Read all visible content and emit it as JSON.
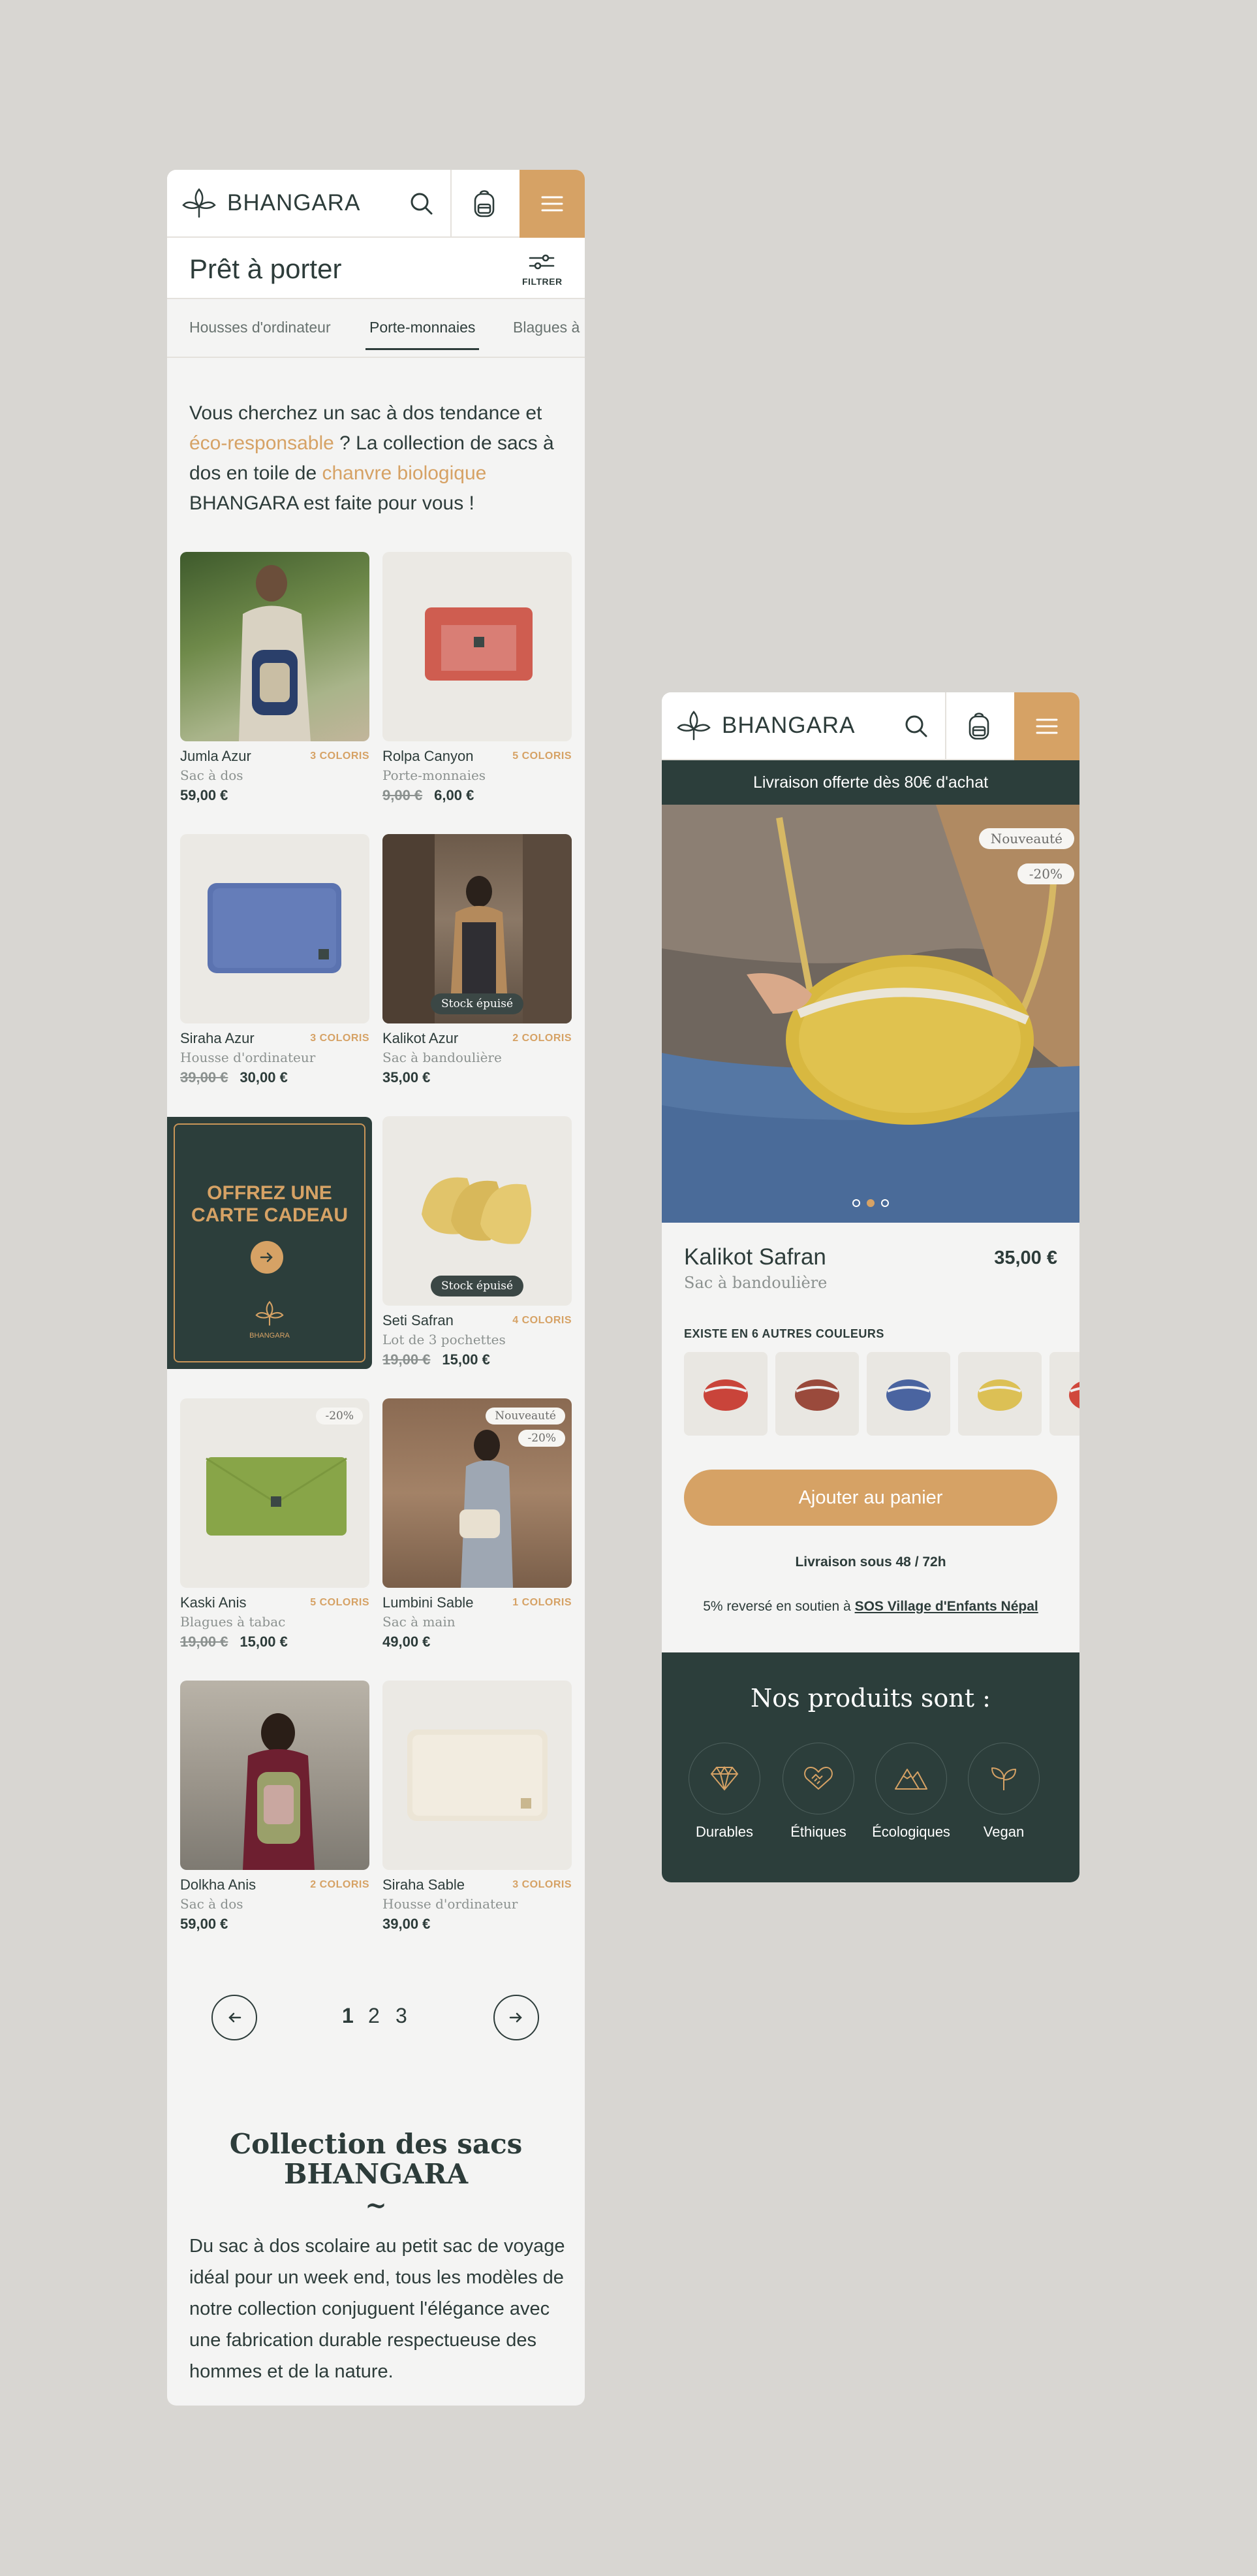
{
  "brand": "BHANGARA",
  "colors": {
    "accent": "#d6a265",
    "dark": "#2c3e3b",
    "background": "#d8d6d2"
  },
  "listing": {
    "title": "Prêt à porter",
    "filter_label": "FILTRER",
    "tabs": [
      "Housses d'ordinateur",
      "Porte-monnaies",
      "Blagues à"
    ],
    "active_tab": "Porte-monnaies",
    "intro": {
      "p1": "Vous cherchez un sac à dos tendance et ",
      "hl1": "éco-responsable",
      "p2": " ? La collection de sacs à dos en toile de ",
      "hl2": "chanvre biologique",
      "p3": " BHANGARA est faite pour vous !"
    },
    "products": [
      {
        "name": "Jumla Azur",
        "colors": "3 COLORIS",
        "category": "Sac à dos",
        "old_price": "",
        "price": "59,00 €"
      },
      {
        "name": "Rolpa Canyon",
        "colors": "5 COLORIS",
        "category": "Porte-monnaies",
        "old_price": "9,00 €",
        "price": "6,00 €"
      },
      {
        "name": "Siraha Azur",
        "colors": "3 COLORIS",
        "category": "Housse d'ordinateur",
        "old_price": "39,00 €",
        "price": "30,00 €"
      },
      {
        "name": "Kalikot Azur",
        "colors": "2 COLORIS",
        "category": "Sac à bandoulière",
        "old_price": "",
        "price": "35,00 €",
        "badge_stock": "Stock épuisé"
      },
      {
        "name": "Seti Safran",
        "colors": "4 COLORIS",
        "category": "Lot de 3 pochettes",
        "old_price": "19,00 €",
        "price": "15,00 €",
        "badge_stock": "Stock épuisé"
      },
      {
        "name": "Kaski Anis",
        "colors": "5 COLORIS",
        "category": "Blagues à tabac",
        "old_price": "19,00 €",
        "price": "15,00 €",
        "badge_discount": "-20%"
      },
      {
        "name": "Lumbini Sable",
        "colors": "1 COLORIS",
        "category": "Sac à main",
        "old_price": "",
        "price": "49,00 €",
        "badge_new": "Nouveauté",
        "badge_discount": "-20%"
      },
      {
        "name": "Dolkha Anis",
        "colors": "2 COLORIS",
        "category": "Sac à dos",
        "old_price": "",
        "price": "59,00 €"
      },
      {
        "name": "Siraha Sable",
        "colors": "3 COLORIS",
        "category": "Housse d'ordinateur",
        "old_price": "",
        "price": "39,00 €"
      }
    ],
    "gift_card": {
      "line1": "OFFREZ UNE",
      "line2": "CARTE CADEAU",
      "brand": "BHANGARA"
    },
    "pagination": [
      "1",
      "2",
      "3"
    ],
    "collection": {
      "title_line1": "Collection des sacs",
      "title_line2": "BHANGARA",
      "tilde": "~",
      "text": "Du sac à dos scolaire au petit sac de voyage idéal pour un week end, tous les modèles de notre collection conjuguent l'élégance avec une fabrication durable respectueuse des hommes et de la nature."
    }
  },
  "product_page": {
    "shipping_banner": "Livraison offerte dès 80€ d'achat",
    "badge_new": "Nouveauté",
    "badge_discount": "-20%",
    "name": "Kalikot Safran",
    "category": "Sac à bandoulière",
    "price": "35,00 €",
    "colors_title": "EXISTE EN 6 AUTRES COULEURS",
    "add_to_cart": "Ajouter au panier",
    "delivery": "Livraison sous 48 / 72h",
    "donation_prefix": "5% reversé en soutien à ",
    "donation_link": "SOS Village d'Enfants Népal",
    "values_title": "Nos produits sont :",
    "values": [
      "Durables",
      "Éthiques",
      "Écologiques",
      "Vegan"
    ]
  }
}
